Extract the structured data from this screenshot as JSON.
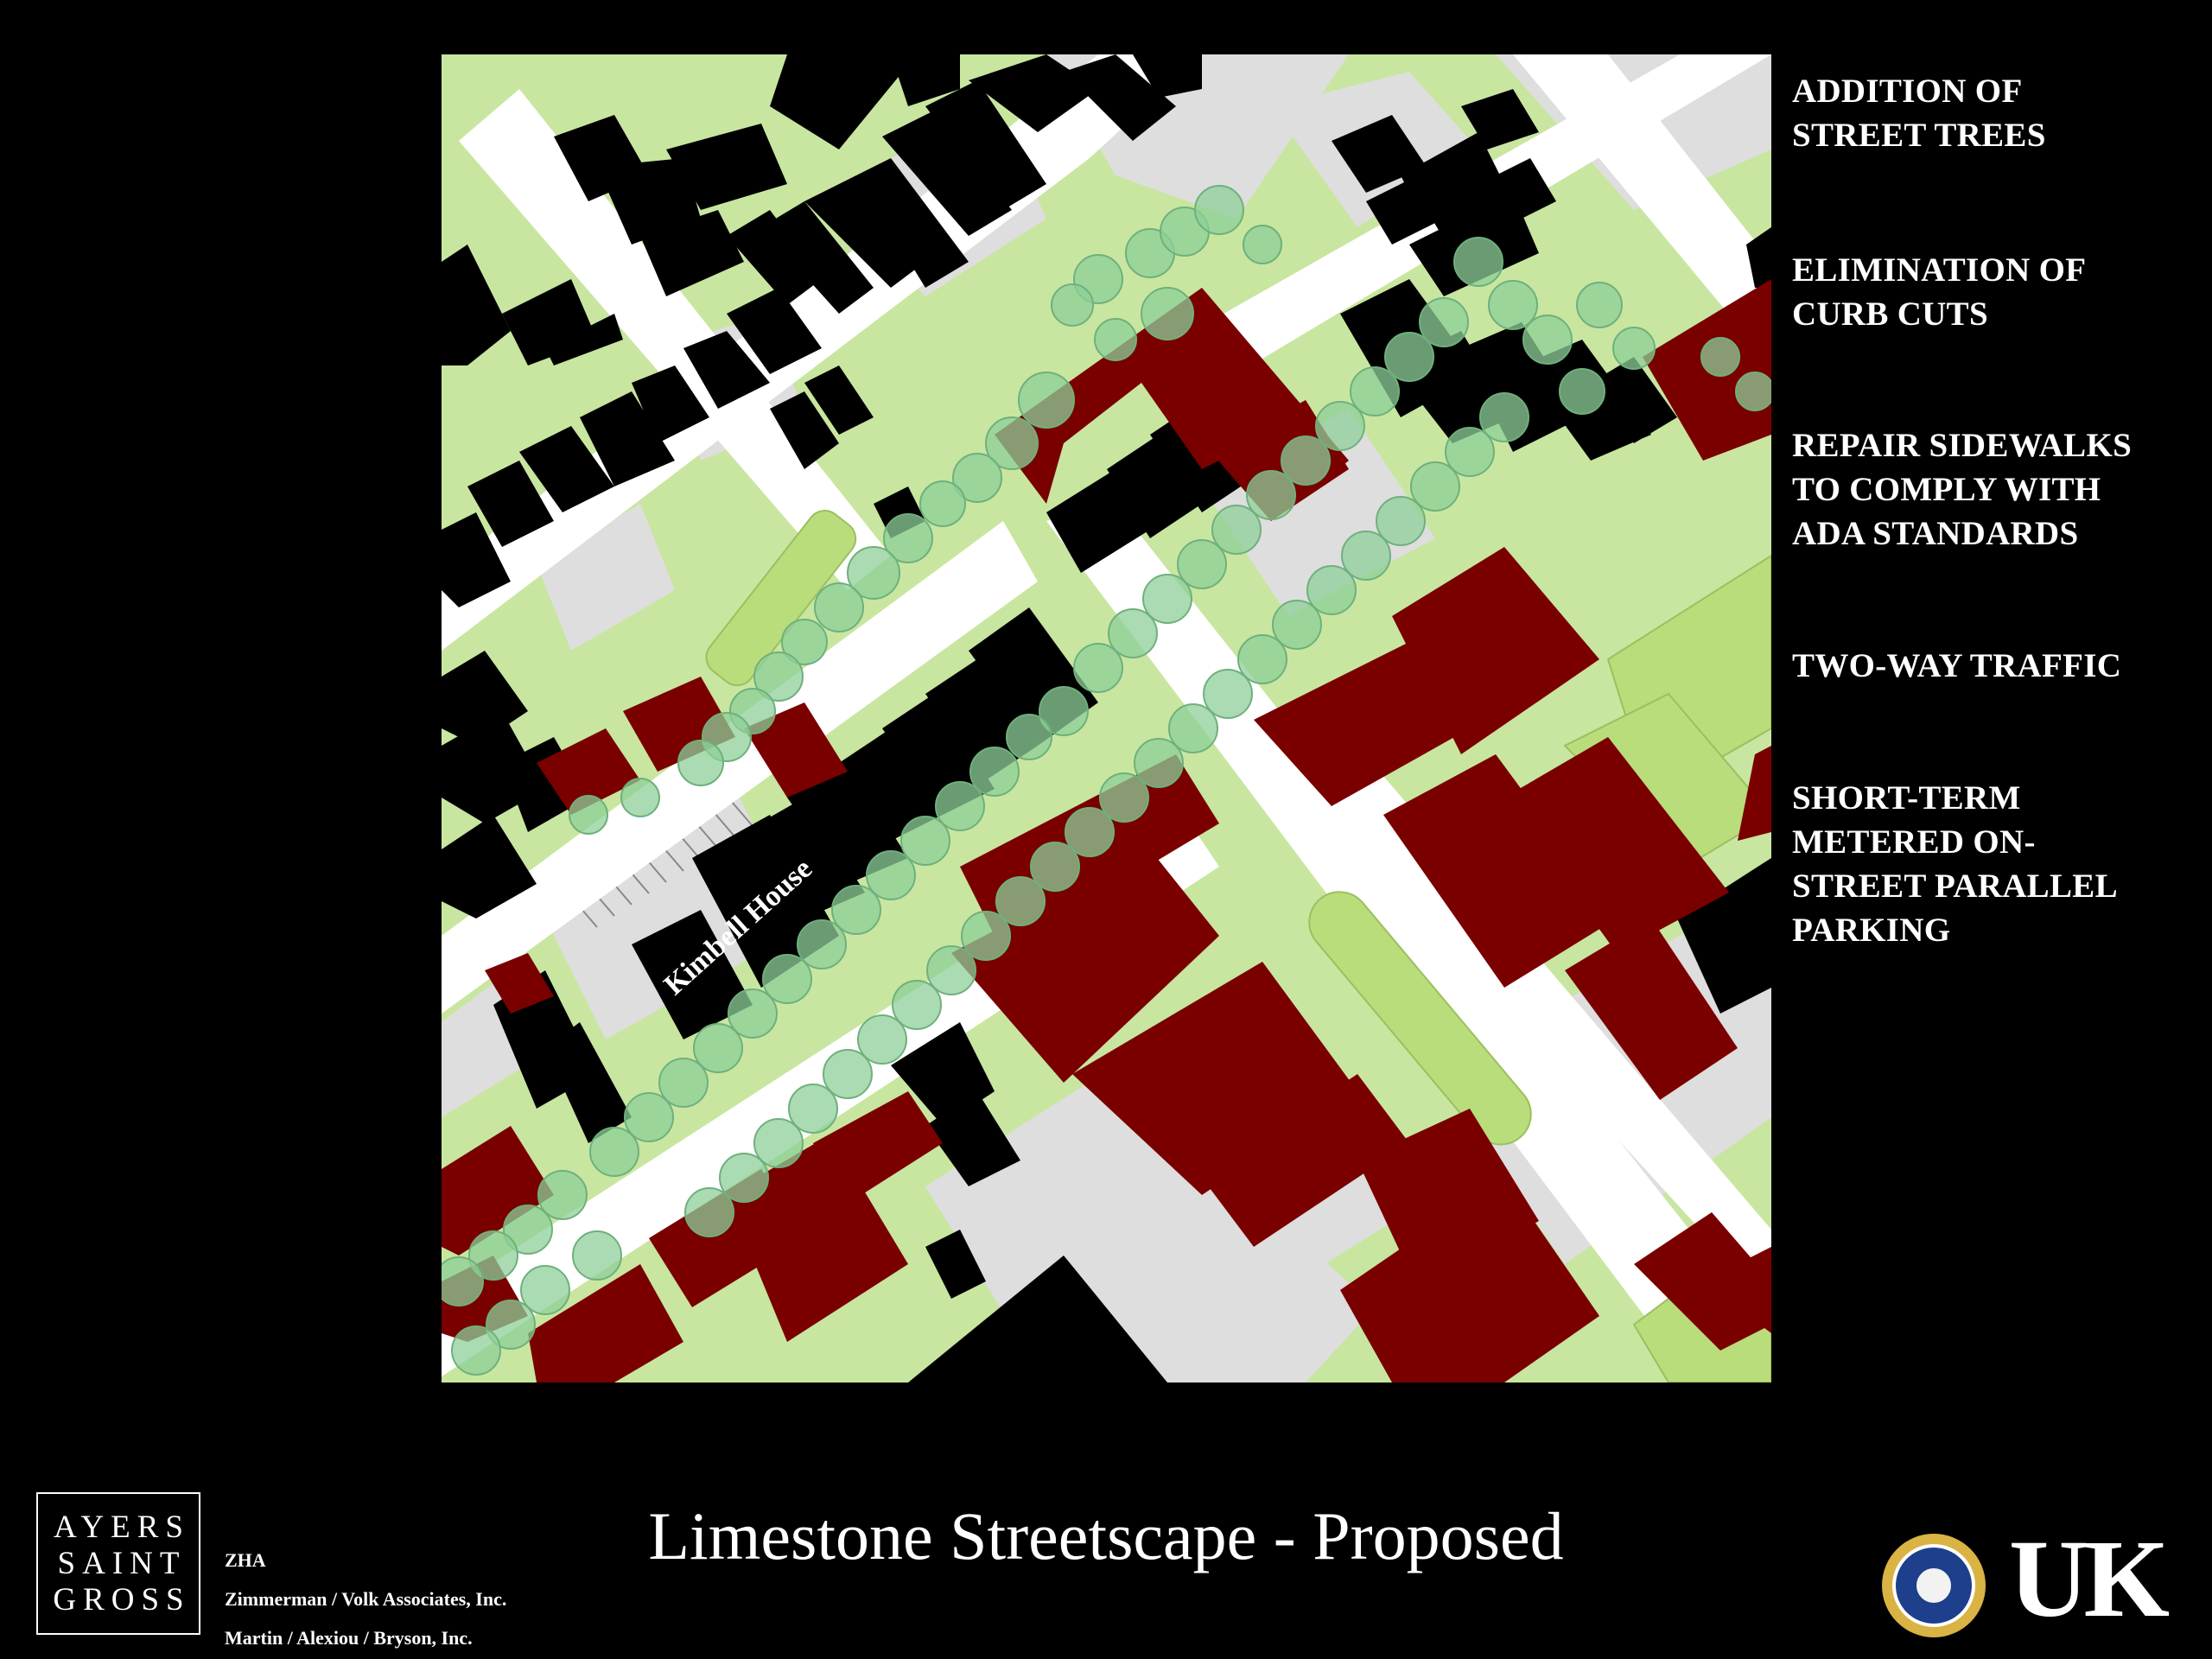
{
  "map": {
    "street_label": "Kimbell House",
    "colors": {
      "grass": "#c8e6a0",
      "street": "#ffffff",
      "existing_building": "#000000",
      "proposed_building": "#7a0000",
      "parking_lot": "#dedede",
      "tree": "#8ecf98",
      "median": "#b8dd7a"
    }
  },
  "bullets": [
    {
      "text": "ADDITION OF\nSTREET TREES"
    },
    {
      "text": "ELIMINATION OF\nCURB CUTS"
    },
    {
      "text": "REPAIR SIDEWALKS\nTO COMPLY WITH\nADA STANDARDS"
    },
    {
      "text": "TWO-WAY TRAFFIC"
    },
    {
      "text": "SHORT-TERM\nMETERED ON-\nSTREET PARALLEL\nPARKING"
    }
  ],
  "title": "Limestone Streetscape - Proposed",
  "logo": {
    "line1": "AYERS",
    "line2": "SAINT",
    "line3": "GROSS"
  },
  "credits": [
    "ZHA",
    "Zimmerman / Volk Associates, Inc.",
    "Martin / Alexiou / Bryson, Inc."
  ],
  "partner_logos": {
    "seal": "lexington-fayette-urban-county-seal-icon",
    "uk_text": "UK"
  }
}
